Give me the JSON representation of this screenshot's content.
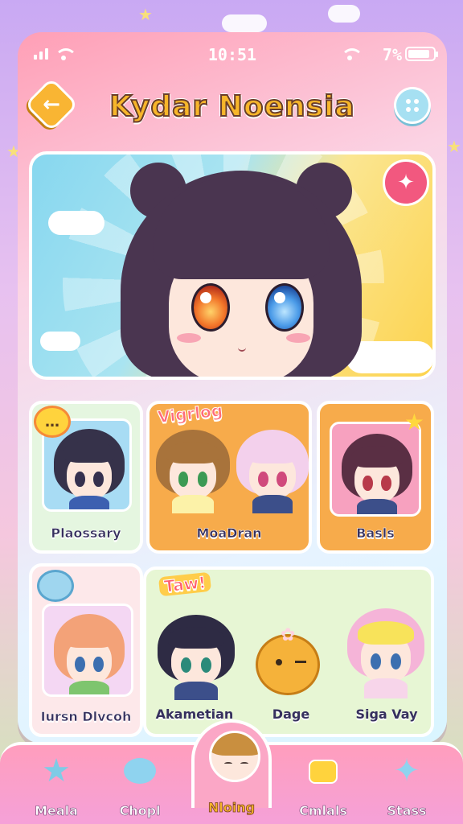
{
  "status_bar": {
    "time": "10:51",
    "battery_text": "7%"
  },
  "header": {
    "title": "Kydar Noensia",
    "back_icon": "arrow-left-icon",
    "menu_icon": "dots-grid-icon"
  },
  "hero": {
    "sticker_icon": "sparkle-sticker-icon"
  },
  "grid": {
    "card1": {
      "label": "Plaossary",
      "bubble_text": "…"
    },
    "card2": {
      "tag": "Vigrlog",
      "label": "MoaDran"
    },
    "card3": {
      "label": "Basls"
    },
    "card4": {
      "label": "Iursn Dlvcoh"
    },
    "card5": {
      "tag": "Taw!",
      "items": [
        "Akametian",
        "Dage",
        "Siga Vay"
      ]
    }
  },
  "nav": {
    "items": [
      {
        "label": "Meala",
        "icon": "star-icon"
      },
      {
        "label": "Chopl",
        "icon": "chat-bubble-icon"
      },
      {
        "label": "Nloing",
        "icon": "avatar-icon"
      },
      {
        "label": "Cmlals",
        "icon": "gift-icon"
      },
      {
        "label": "Stass",
        "icon": "sparkle-icon"
      }
    ]
  },
  "colors": {
    "accent": "#f7b62a",
    "pink": "#ff9fb6",
    "sky": "#87d7ef"
  }
}
